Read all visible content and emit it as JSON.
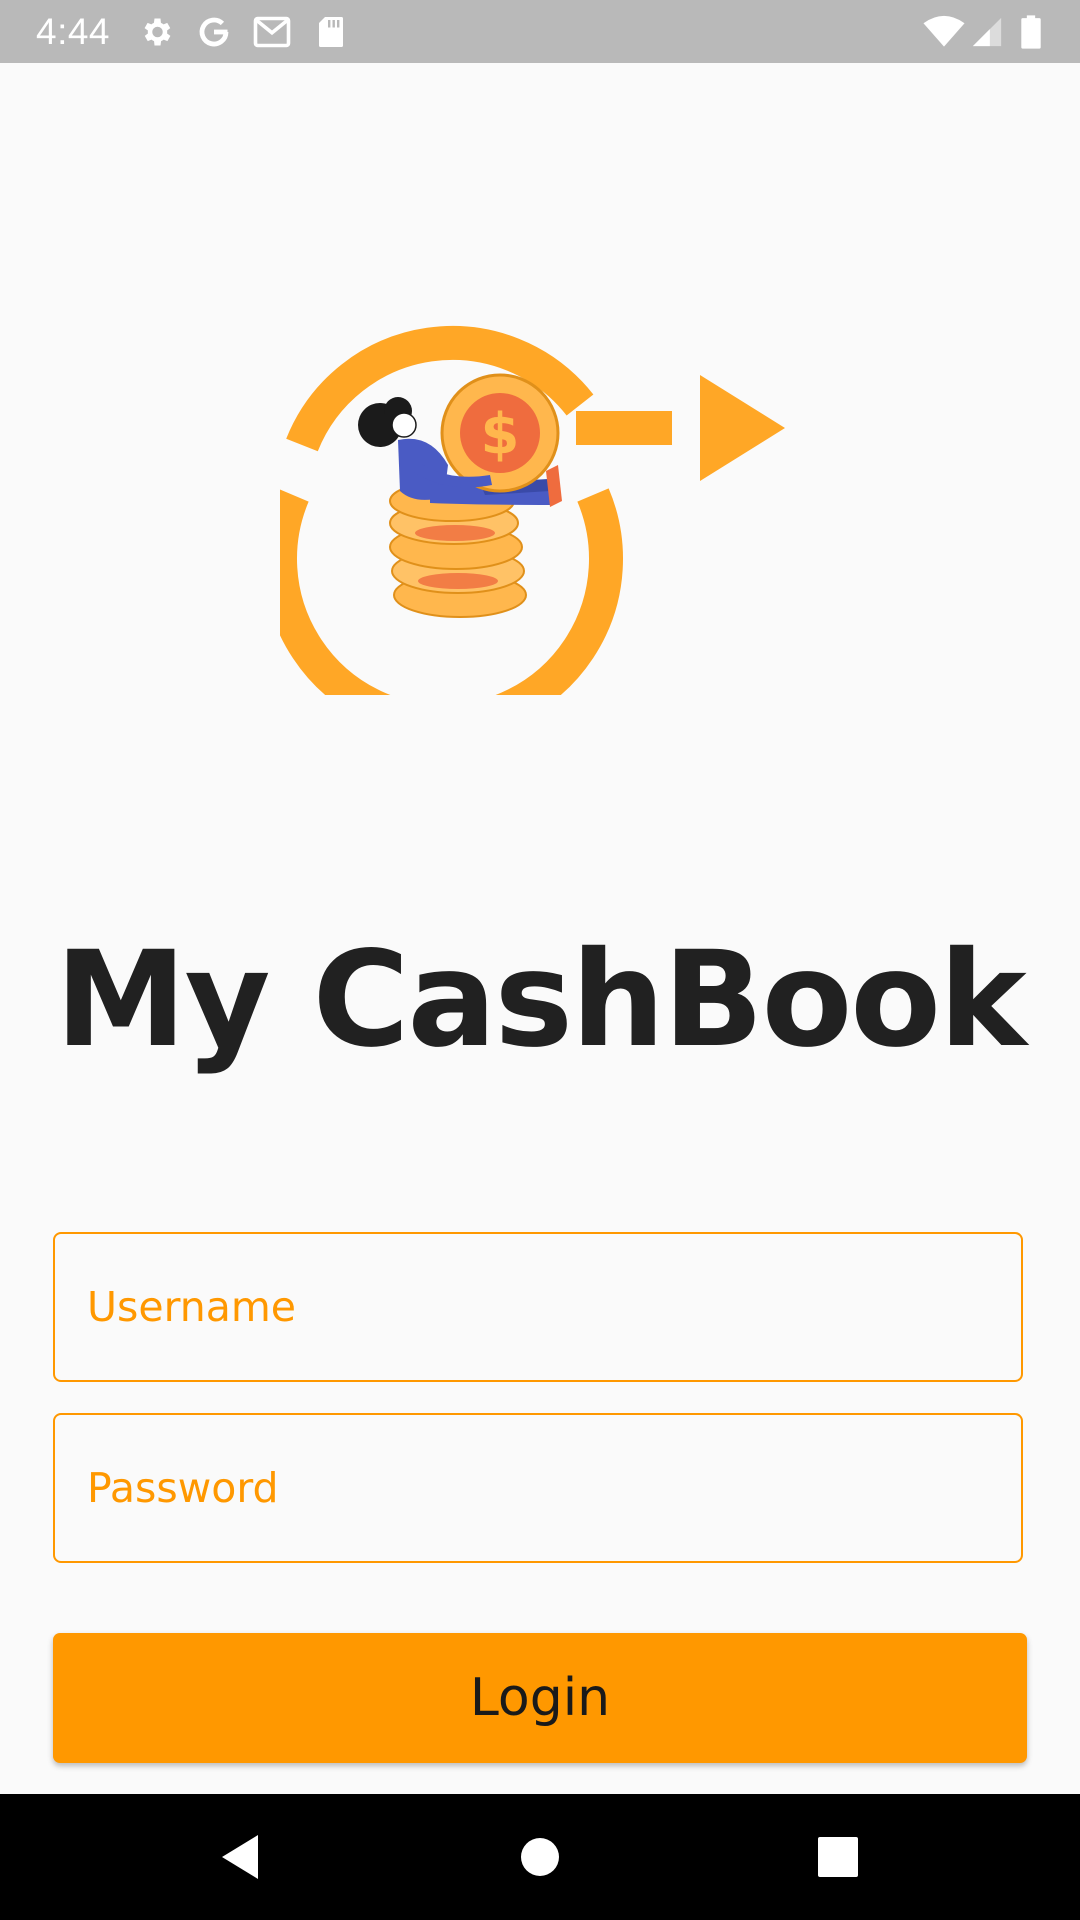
{
  "status_bar": {
    "time": "4:44",
    "left_icons": [
      "gear-icon",
      "google-icon",
      "gmail-icon",
      "sd-card-icon"
    ],
    "right_icons": [
      "wifi-icon",
      "cellular-signal-icon",
      "battery-icon"
    ]
  },
  "app": {
    "title": "My CashBook",
    "logo_icon": "cashbook-logo-icon"
  },
  "form": {
    "username_placeholder": "Username",
    "username_value": "",
    "password_placeholder": "Password",
    "password_value": "",
    "login_label": "Login"
  },
  "nav_bar": {
    "buttons": [
      "back-icon",
      "home-icon",
      "recents-icon"
    ]
  },
  "colors": {
    "accent": "#ff9800",
    "logo_orange": "#ffa726",
    "coin_red": "#ef6c3e",
    "figure_blue": "#4a5bc4",
    "title": "#212121",
    "status_bar": "#b9b9b9",
    "nav_bar": "#000000",
    "background": "#fafafa"
  }
}
